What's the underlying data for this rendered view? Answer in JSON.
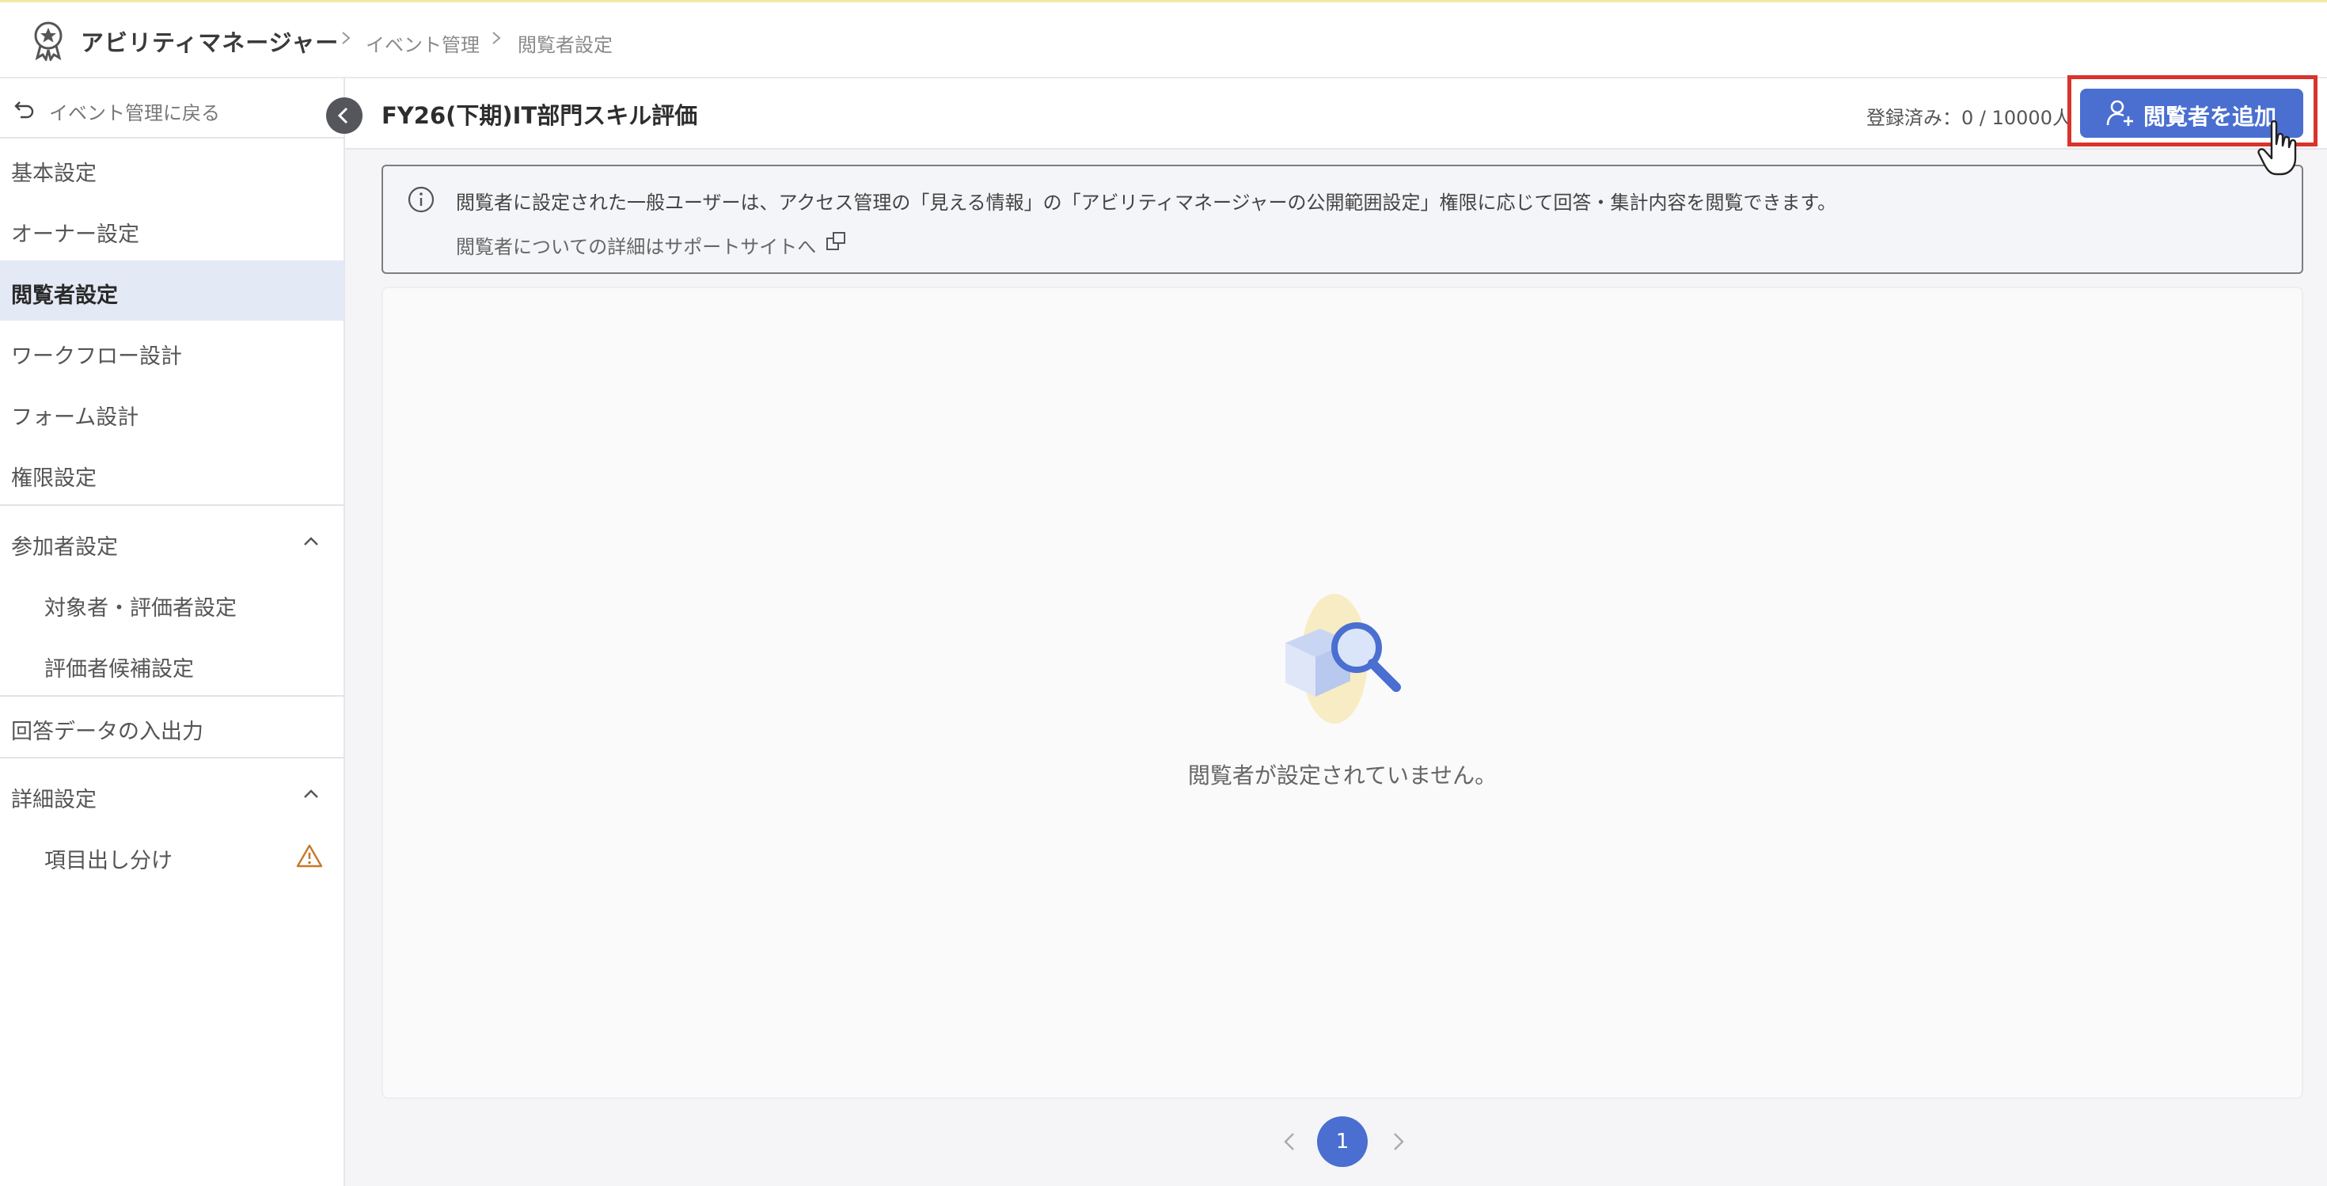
{
  "header": {
    "app_name": "アビリティマネージャー",
    "breadcrumbs": [
      "イベント管理",
      "閲覧者設定"
    ]
  },
  "sidebar": {
    "back_label": "イベント管理に戻る",
    "items": [
      {
        "label": "基本設定"
      },
      {
        "label": "オーナー設定"
      },
      {
        "label": "閲覧者設定",
        "active": true
      },
      {
        "label": "ワークフロー設計"
      },
      {
        "label": "フォーム設計"
      },
      {
        "label": "権限設定"
      }
    ],
    "participants_group": {
      "label": "参加者設定",
      "children": [
        "対象者・評価者設定",
        "評価者候補設定"
      ]
    },
    "data_io_label": "回答データの入出力",
    "advanced_group": {
      "label": "詳細設定",
      "children": [
        "項目出し分け"
      ]
    }
  },
  "content": {
    "event_title": "FY26(下期)IT部門スキル評価",
    "registered_count": "登録済み：0 / 10000人",
    "add_button_label": "閲覧者を追加",
    "info_text": "閲覧者に設定された一般ユーザーは、アクセス管理の「見える情報」の「アビリティマネージャーの公開範囲設定」権限に応じて回答・集計内容を閲覧できます。",
    "info_link": "閲覧者についての詳細はサポートサイトへ",
    "empty_message": "閲覧者が設定されていません。"
  },
  "pagination": {
    "current_page": "1"
  },
  "colors": {
    "accent": "#4a6fd0",
    "active_nav_bg": "#e4e9f6",
    "highlight_border": "#d9342b",
    "warning": "#c8782a"
  }
}
